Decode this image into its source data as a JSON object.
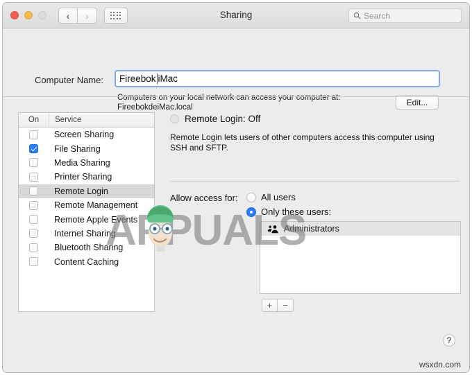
{
  "window": {
    "title": "Sharing",
    "traffic_lights": [
      "close",
      "minimize",
      "zoom-disabled"
    ],
    "nav": {
      "back": "‹",
      "forward": "›"
    },
    "grid_button": "show-all-grid-icon",
    "search": {
      "placeholder": "Search",
      "value": ""
    }
  },
  "computer_name": {
    "label": "Computer Name:",
    "value_before_caret": "Fireebok",
    "value_after_caret": "iMac",
    "note_line1": "Computers on your local network can access your computer at:",
    "note_line2": "FireebokdeiMac.local",
    "edit_button": "Edit..."
  },
  "services": {
    "header": {
      "on": "On",
      "service": "Service"
    },
    "items": [
      {
        "name": "Screen Sharing",
        "checked": false,
        "selected": false
      },
      {
        "name": "File Sharing",
        "checked": true,
        "selected": false
      },
      {
        "name": "Media Sharing",
        "checked": false,
        "selected": false
      },
      {
        "name": "Printer Sharing",
        "checked": false,
        "selected": false
      },
      {
        "name": "Remote Login",
        "checked": false,
        "selected": true
      },
      {
        "name": "Remote Management",
        "checked": false,
        "selected": false
      },
      {
        "name": "Remote Apple Events",
        "checked": false,
        "selected": false
      },
      {
        "name": "Internet Sharing",
        "checked": false,
        "selected": false
      },
      {
        "name": "Bluetooth Sharing",
        "checked": false,
        "selected": false
      },
      {
        "name": "Content Caching",
        "checked": false,
        "selected": false
      }
    ]
  },
  "detail": {
    "status": "Remote Login: Off",
    "status_indicator": "off",
    "description": "Remote Login lets users of other computers access this computer using SSH and SFTP.",
    "access_label": "Allow access for:",
    "options": [
      {
        "label": "All users",
        "selected": false
      },
      {
        "label": "Only these users:",
        "selected": true
      }
    ],
    "users": [
      {
        "name": "Administrators",
        "icon": "group-icon"
      }
    ],
    "add_button": "+",
    "remove_button": "−"
  },
  "help_button": "?",
  "watermarks": {
    "brand": "APPUALS",
    "site": "wsxdn.com"
  },
  "colors": {
    "accent": "#2b7cf5",
    "window_bg": "#ececec",
    "selection": "#d8d8d8",
    "focus_ring": "#7fa9e8"
  }
}
